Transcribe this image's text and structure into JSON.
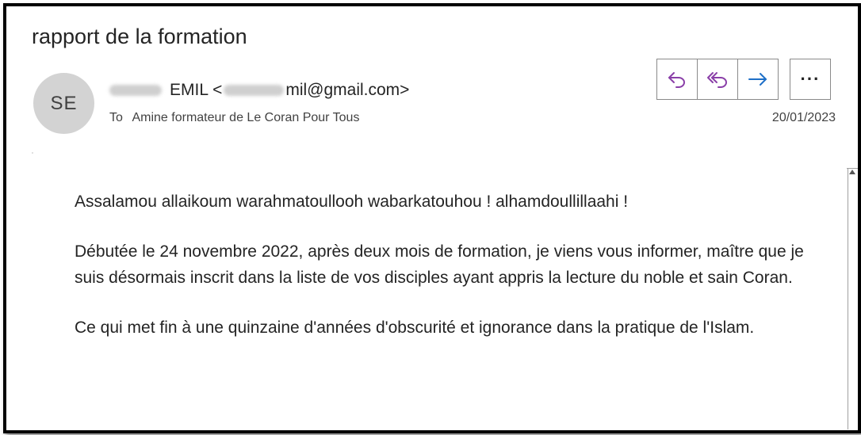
{
  "email": {
    "subject": "rapport de la formation",
    "avatar_initials": "SE",
    "sender_name_visible": "EMIL <",
    "sender_email_visible": "mil@gmail.com>",
    "to_label": "To",
    "to_recipient": "Amine formateur de Le Coran Pour Tous",
    "date": "20/01/2023",
    "body": [
      "Assalamou allaikoum warahmatoullooh wabarkatouhou ! alhamdoullillaahi !",
      "Débutée le 24 novembre 2022, après deux mois de formation, je viens vous informer, maître que je suis désormais inscrit dans la liste de vos disciples ayant appris la lecture du noble et sain Coran.",
      "Ce qui met fin à une quinzaine d'années d'obscurité et ignorance dans la pratique de l'Islam."
    ]
  },
  "toolbar": {
    "reply_icon": "reply-icon",
    "reply_all_icon": "reply-all-icon",
    "forward_icon": "forward-icon",
    "more_label": "···"
  },
  "colors": {
    "reply_purple": "#8a3fa8",
    "forward_blue": "#1e6fc7",
    "avatar_bg": "#d3d3d3"
  }
}
